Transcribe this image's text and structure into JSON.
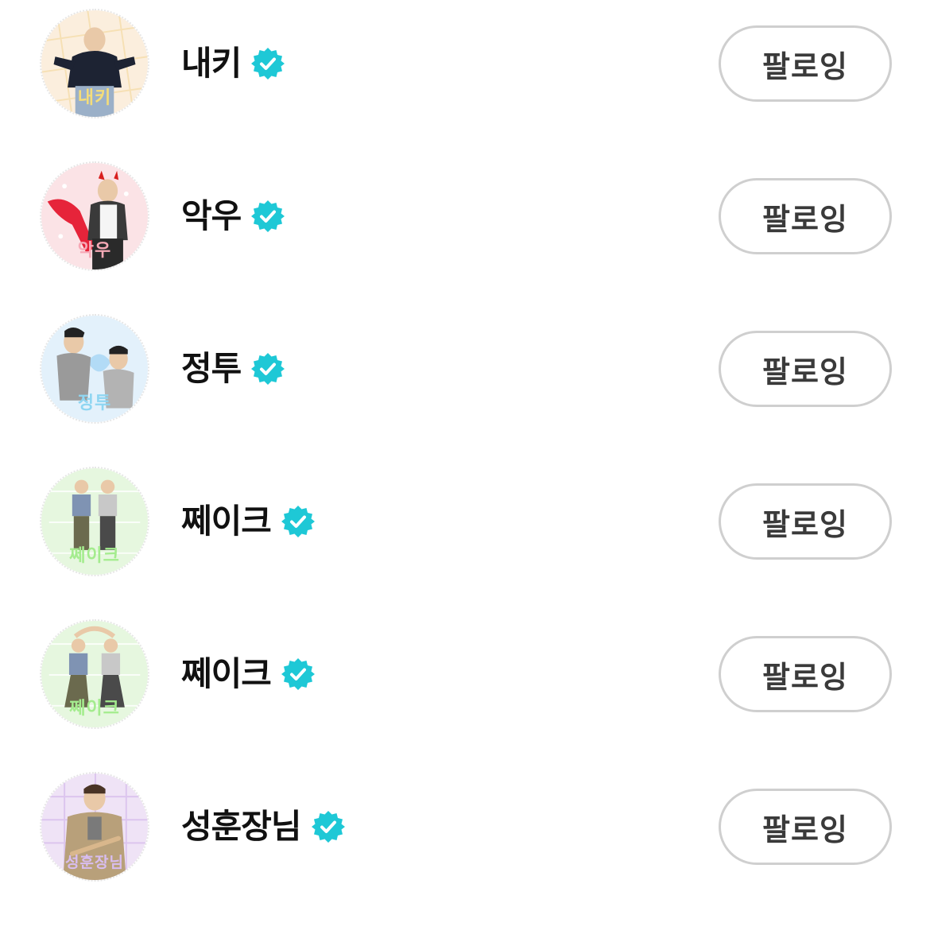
{
  "follow_list": {
    "items": [
      {
        "name": "내키",
        "avatar_caption": "내키",
        "avatar_bg": "#fbeedd",
        "avatar_accent": "#f3d79a",
        "caption_color": "#f4dd7a",
        "verified": true,
        "button_label": "팔로잉"
      },
      {
        "name": "악우",
        "avatar_caption": "악우",
        "avatar_bg": "#fbe3e6",
        "avatar_accent": "#e6243a",
        "caption_color": "#f6a9b6",
        "verified": true,
        "button_label": "팔로잉"
      },
      {
        "name": "정투",
        "avatar_caption": "정투",
        "avatar_bg": "#e3f1fb",
        "avatar_accent": "#9cd2f4",
        "caption_color": "#8fd6f2",
        "verified": true,
        "button_label": "팔로잉"
      },
      {
        "name": "쩨이크",
        "avatar_caption": "쩨이크",
        "avatar_bg": "#e6f7df",
        "avatar_accent": "#a9e89a",
        "caption_color": "#a4ec8e",
        "verified": true,
        "button_label": "팔로잉"
      },
      {
        "name": "쩨이크",
        "avatar_caption": "쩨이크",
        "avatar_bg": "#e6f7df",
        "avatar_accent": "#a9e89a",
        "caption_color": "#a4ec8e",
        "verified": true,
        "button_label": "팔로잉"
      },
      {
        "name": "성훈장님",
        "avatar_caption": "성훈장님",
        "avatar_bg": "#efe3f6",
        "avatar_accent": "#c9a7e6",
        "caption_color": "#d8bdf0",
        "verified": true,
        "button_label": "팔로잉"
      }
    ]
  },
  "icons": {
    "verified": "verified-badge-icon"
  },
  "colors": {
    "verified_badge": "#1ec8d6",
    "button_border": "#cfcfcf",
    "button_text": "#3a3a3a",
    "name_text": "#111111"
  }
}
